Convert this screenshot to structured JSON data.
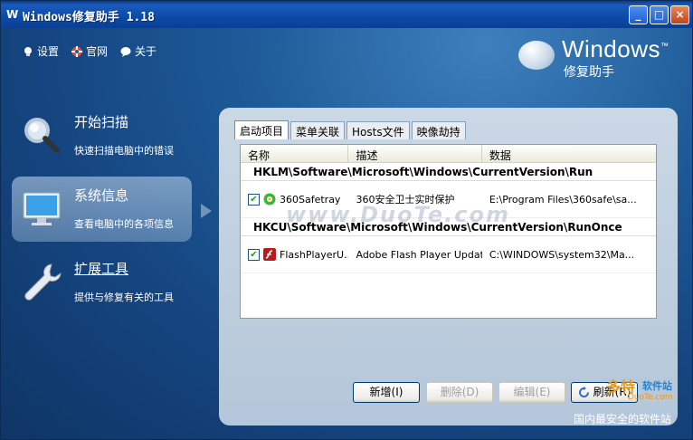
{
  "window": {
    "title": "Windows修复助手 1.18"
  },
  "titlebar_buttons": {
    "minimize": "_",
    "maximize": "□",
    "close": "×"
  },
  "toplinks": [
    {
      "label": "设置",
      "icon": "bulb-icon"
    },
    {
      "label": "官网",
      "icon": "lifebuoy-icon"
    },
    {
      "label": "关于",
      "icon": "chat-icon"
    }
  ],
  "logo": {
    "word": "Windows",
    "tm": "™",
    "sub": "修复助手"
  },
  "nav": [
    {
      "title": "开始扫描",
      "desc": "快速扫描电脑中的错误",
      "icon": "magnifier-icon",
      "active": false
    },
    {
      "title": "系统信息",
      "desc": "查看电脑中的各项信息",
      "icon": "monitor-icon",
      "active": true
    },
    {
      "title": "扩展工具",
      "desc": "提供与修复有关的工具",
      "icon": "wrench-icon",
      "active": false
    }
  ],
  "tabs": [
    "启动项目",
    "菜单关联",
    "Hosts文件",
    "映像劫持"
  ],
  "list": {
    "columns": [
      "名称",
      "描述",
      "数据"
    ],
    "groups": [
      {
        "path": "HKLM\\Software\\Microsoft\\Windows\\CurrentVersion\\Run",
        "rows": [
          {
            "name": "360Safetray",
            "desc": "360安全卫士实时保护",
            "data": "E:\\Program Files\\360safe\\sa...",
            "checked": true
          }
        ]
      },
      {
        "path": "HKCU\\Software\\Microsoft\\Windows\\CurrentVersion\\RunOnce",
        "rows": [
          {
            "name": "FlashPlayerU...",
            "desc": "Adobe Flash Player Updat...",
            "data": "C:\\WINDOWS\\system32\\Ma...",
            "checked": true
          }
        ]
      }
    ]
  },
  "buttons": {
    "add": "新增(I)",
    "delete": "删除(D)",
    "edit": "编辑(E)",
    "refresh": "刷新(R)"
  },
  "watermark": "www.DuoTe.com",
  "brand": {
    "line1": "多特",
    "line2": "软件站",
    "line3": "DuoTe.com",
    "line4": "国内最安全的软件站"
  },
  "colors": {
    "accent": "#1d5a97",
    "title": "#0c4aa8"
  }
}
